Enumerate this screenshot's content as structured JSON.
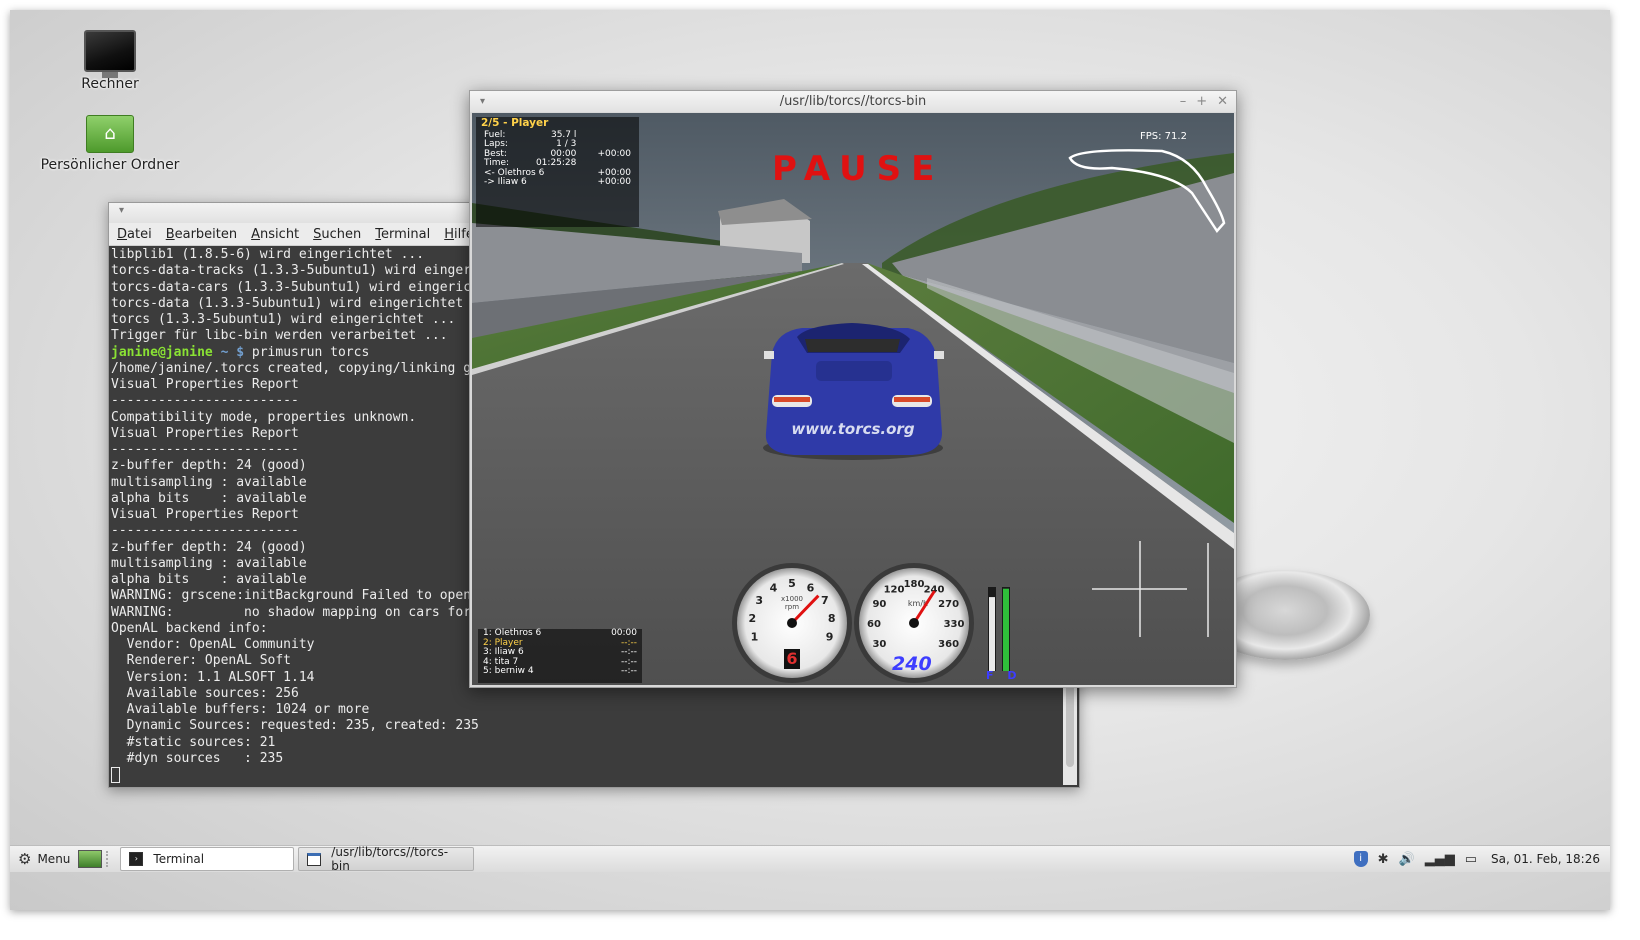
{
  "desktop": {
    "icons": [
      {
        "label": "Rechner",
        "icon": "computer-icon"
      },
      {
        "label": "Persönlicher Ordner",
        "icon": "home-folder-icon"
      }
    ]
  },
  "terminal": {
    "menu": [
      "Datei",
      "Bearbeiten",
      "Ansicht",
      "Suchen",
      "Terminal",
      "Hilfe"
    ],
    "lines": [
      "libplib1 (1.8.5-6) wird eingerichtet ...",
      "torcs-data-tracks (1.3.3-5ubuntu1) wird eingeri",
      "torcs-data-cars (1.3.3-5ubuntu1) wird eingerich",
      "torcs-data (1.3.3-5ubuntu1) wird eingerichtet .",
      "torcs (1.3.3-5ubuntu1) wird eingerichtet ...",
      "Trigger für libc-bin werden verarbeitet ...",
      "__PROMPT__",
      "/home/janine/.torcs created, copying/linking ga",
      "Visual Properties Report",
      "------------------------",
      "Compatibility mode, properties unknown.",
      "Visual Properties Report",
      "------------------------",
      "z-buffer depth: 24 (good)",
      "multisampling : available",
      "alpha bits    : available",
      "Visual Properties Report",
      "------------------------",
      "z-buffer depth: 24 (good)",
      "multisampling : available",
      "alpha bits    : available",
      "WARNING: grscene:initBackground Failed to open",
      "WARNING:         no shadow mapping on cars for",
      "OpenAL backend info:",
      "  Vendor: OpenAL Community",
      "  Renderer: OpenAL Soft",
      "  Version: 1.1 ALSOFT 1.14",
      "  Available sources: 256",
      "  Available buffers: 1024 or more",
      "  Dynamic Sources: requested: 235, created: 235",
      "  #static sources: 21",
      "  #dyn sources   : 235"
    ],
    "prompt": {
      "user": "janine@janine",
      "path": " ~ ",
      "symbol": "$",
      "command": " primusrun torcs"
    }
  },
  "game_window": {
    "title": "/usr/lib/torcs//torcs-bin",
    "pause_text": "PAUSE",
    "fps": "FPS: 71.2",
    "car_decal": "www.torcs.org",
    "info": {
      "header": "2/5 - Player",
      "rows": [
        {
          "k": "Fuel:",
          "v": "35.7 l",
          "d": ""
        },
        {
          "k": "Laps:",
          "v": "1 / 3",
          "d": ""
        },
        {
          "k": "Best:",
          "v": "00:00",
          "d": "+00:00"
        },
        {
          "k": "Time:",
          "v": "01:25:28",
          "d": ""
        },
        {
          "k": "<- Olethros 6",
          "v": "",
          "d": "+00:00"
        },
        {
          "k": "-> Iliaw 6",
          "v": "",
          "d": "+00:00"
        }
      ]
    },
    "ranking": [
      {
        "name": "1: Olethros 6",
        "time": "00:00",
        "player": false
      },
      {
        "name": "2: Player",
        "time": "--:--",
        "player": true
      },
      {
        "name": "3: Iliaw 6",
        "time": "--:--",
        "player": false
      },
      {
        "name": "4: tita 7",
        "time": "--:--",
        "player": false
      },
      {
        "name": "5: berniw 4",
        "time": "--:--",
        "player": false
      }
    ],
    "rpm_gauge": {
      "ticks": [
        "1",
        "2",
        "3",
        "4",
        "5",
        "6",
        "7",
        "8",
        "9"
      ],
      "unit_top": "x1000",
      "unit_bottom": "rpm",
      "gear": "6",
      "needle_value": 6.6
    },
    "speed_gauge": {
      "ticks": [
        "30",
        "60",
        "90",
        "120",
        "180",
        "240",
        "270",
        "330",
        "360"
      ],
      "unit": "km/h",
      "speed": "240",
      "needle_value": 240
    },
    "bars": {
      "label": "F D",
      "fuel_level": 0.88,
      "damage_level": 0.98
    }
  },
  "taskbar": {
    "menu_label": "Menu",
    "tasks": [
      {
        "label": "Terminal",
        "icon": "terminal-icon"
      },
      {
        "label": "/usr/lib/torcs//torcs-bin",
        "icon": "window-icon"
      }
    ],
    "clock": "Sa, 01. Feb, 18:26"
  },
  "colors": {
    "prompt_user": "#8ae234",
    "pause": "#e01111",
    "hud_highlight": "#ffd24a"
  }
}
